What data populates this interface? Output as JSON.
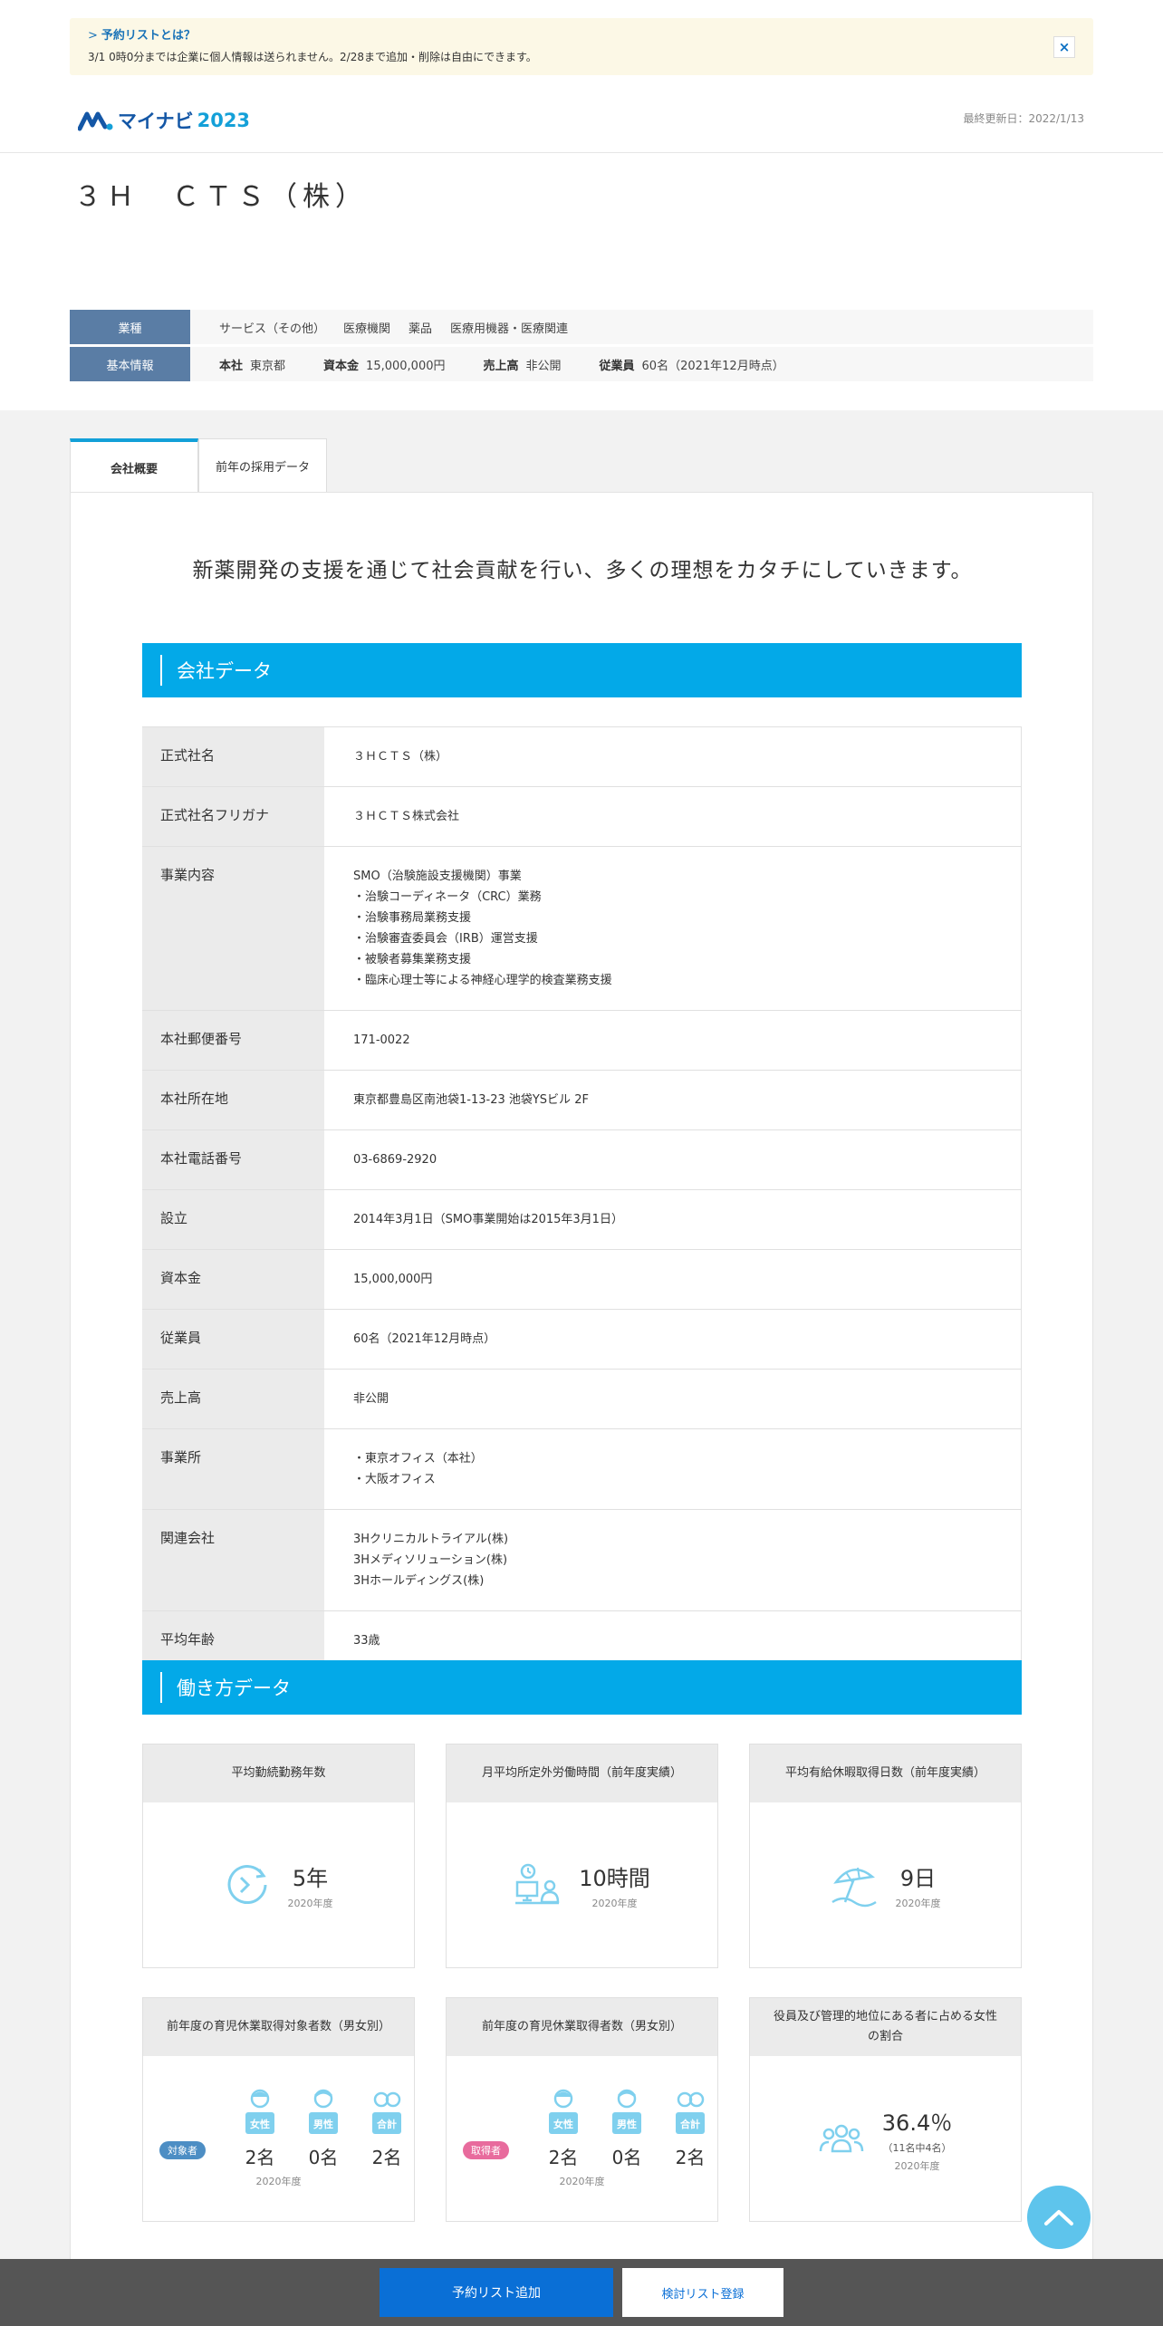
{
  "notice": {
    "title": "予約リストとは？",
    "text": "3/1 0時0分までは企業に個人情報は送られません。2/28まで追加・削除は自由にできます。",
    "close": "×"
  },
  "header": {
    "logo_text": "マイナビ",
    "logo_year": "2023",
    "updated": "最終更新日：2022/1/13"
  },
  "company": {
    "name": "３Ｈ　ＣＴＳ（株）"
  },
  "summary": {
    "industry_label": "業種",
    "industries": [
      "サービス（その他）",
      "医療機関",
      "薬品",
      "医療用機器・医療関連"
    ],
    "basic_label": "基本情報",
    "hq_key": "本社",
    "hq_val": "東京都",
    "capital_key": "資本金",
    "capital_val": "15,000,000円",
    "sales_key": "売上高",
    "sales_val": "非公開",
    "employees_key": "従業員",
    "employees_val": "60名（2021年12月時点）"
  },
  "tabs": [
    "会社概要",
    "前年の採用データ"
  ],
  "catch_copy": "新薬開発の支援を通じて社会貢献を行い、多くの理想をカタチにしていきます。",
  "company_section": {
    "title": "会社データ",
    "rows": [
      {
        "label": "正式社名",
        "lines": [
          "３ＨＣＴＳ（株）"
        ]
      },
      {
        "label": "正式社名フリガナ",
        "lines": [
          "３ＨＣＴＳ株式会社"
        ]
      },
      {
        "label": "事業内容",
        "lines": [
          "SMO（治験施設支援機関）事業",
          "・治験コーディネータ（CRC）業務",
          "・治験事務局業務支援",
          "・治験審査委員会（IRB）運営支援",
          "・被験者募集業務支援",
          "・臨床心理士等による神経心理学的検査業務支援"
        ]
      },
      {
        "label": "本社郵便番号",
        "lines": [
          "171-0022"
        ]
      },
      {
        "label": "本社所在地",
        "lines": [
          "東京都豊島区南池袋1-13-23 池袋YSビル 2F"
        ]
      },
      {
        "label": "本社電話番号",
        "lines": [
          "03-6869-2920"
        ]
      },
      {
        "label": "設立",
        "lines": [
          "2014年3月1日（SMO事業開始は2015年3月1日）"
        ]
      },
      {
        "label": "資本金",
        "lines": [
          "15,000,000円"
        ]
      },
      {
        "label": "従業員",
        "lines": [
          "60名（2021年12月時点）"
        ]
      },
      {
        "label": "売上高",
        "lines": [
          "非公開"
        ]
      },
      {
        "label": "事業所",
        "lines": [
          "・東京オフィス（本社）",
          "・大阪オフィス"
        ]
      },
      {
        "label": "関連会社",
        "lines": [
          "3Hクリニカルトライアル(株)",
          "3Hメディソリューション(株)",
          "3Hホールディングス(株)"
        ]
      },
      {
        "label": "平均年齢",
        "lines": [
          "33歳"
        ]
      }
    ]
  },
  "work_section": {
    "title": "働き方データ",
    "cards": [
      {
        "head": "平均勤続勤務年数",
        "value": "5年",
        "year": "2020年度",
        "icon": "clock-arrow-icon"
      },
      {
        "head": "月平均所定外労働時間（前年度実績）",
        "value": "10時間",
        "year": "2020年度",
        "icon": "desk-worker-icon"
      },
      {
        "head": "平均有給休暇取得日数（前年度実績）",
        "value": "9日",
        "year": "2020年度",
        "icon": "beach-umbrella-icon"
      }
    ],
    "leave_target": {
      "head": "前年度の育児休業取得対象者数（男女別）",
      "badge": "対象者",
      "female_label": "女性",
      "female": "2名",
      "male_label": "男性",
      "male": "0名",
      "total_label": "合計",
      "total": "2名",
      "year": "2020年度"
    },
    "leave_taken": {
      "head": "前年度の育児休業取得者数（男女別）",
      "badge": "取得者",
      "female_label": "女性",
      "female": "2名",
      "male_label": "男性",
      "male": "0名",
      "total_label": "合計",
      "total": "2名",
      "year": "2020年度"
    },
    "women_managers": {
      "head": "役員及び管理的地位にある者に占める女性の割合",
      "value": "36.4％",
      "detail": "（11名中4名）",
      "year": "2020年度"
    }
  },
  "bottom": {
    "primary": "予約リスト追加",
    "secondary": "検討リスト登録"
  },
  "colors": {
    "accent": "#03a9e8",
    "label_bg": "#5a7da5",
    "icon": "#7fd0ee",
    "primary_button": "#0a6fd6"
  }
}
